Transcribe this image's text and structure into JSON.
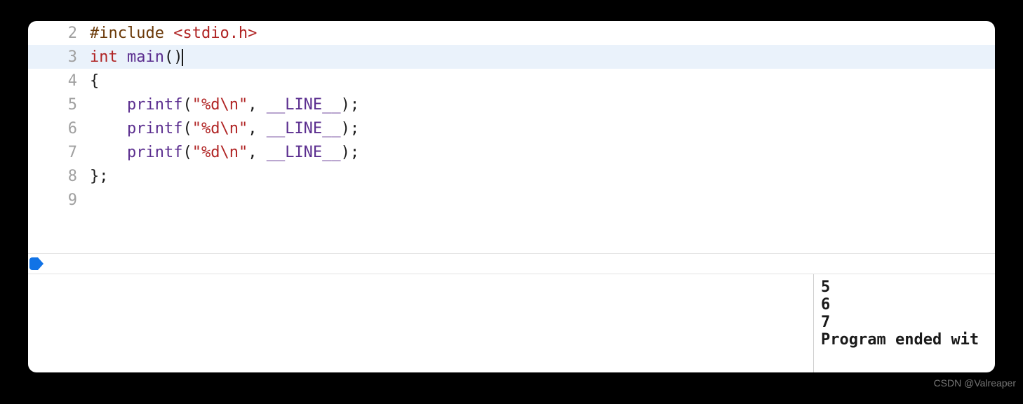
{
  "editor": {
    "lines": [
      {
        "num": "2",
        "highlighted": false,
        "tokens": [
          {
            "cls": "tok-preproc",
            "text": "#include "
          },
          {
            "cls": "tok-include-path",
            "text": "<stdio.h>"
          }
        ]
      },
      {
        "num": "3",
        "highlighted": true,
        "tokens": [
          {
            "cls": "tok-keyword",
            "text": "int "
          },
          {
            "cls": "tok-func",
            "text": "main"
          },
          {
            "cls": "tok-plain",
            "text": "()"
          }
        ],
        "cursor_after": true
      },
      {
        "num": "4",
        "highlighted": false,
        "tokens": [
          {
            "cls": "tok-plain",
            "text": "{"
          }
        ]
      },
      {
        "num": "5",
        "highlighted": false,
        "tokens": [
          {
            "cls": "tok-plain",
            "text": "    "
          },
          {
            "cls": "tok-func",
            "text": "printf"
          },
          {
            "cls": "tok-plain",
            "text": "("
          },
          {
            "cls": "tok-string",
            "text": "\"%d\\n\""
          },
          {
            "cls": "tok-plain",
            "text": ", "
          },
          {
            "cls": "tok-macro",
            "text": "__LINE__"
          },
          {
            "cls": "tok-plain",
            "text": ");"
          }
        ]
      },
      {
        "num": "6",
        "highlighted": false,
        "tokens": [
          {
            "cls": "tok-plain",
            "text": "    "
          },
          {
            "cls": "tok-func",
            "text": "printf"
          },
          {
            "cls": "tok-plain",
            "text": "("
          },
          {
            "cls": "tok-string",
            "text": "\"%d\\n\""
          },
          {
            "cls": "tok-plain",
            "text": ", "
          },
          {
            "cls": "tok-macro",
            "text": "__LINE__"
          },
          {
            "cls": "tok-plain",
            "text": ");"
          }
        ]
      },
      {
        "num": "7",
        "highlighted": false,
        "tokens": [
          {
            "cls": "tok-plain",
            "text": "    "
          },
          {
            "cls": "tok-func",
            "text": "printf"
          },
          {
            "cls": "tok-plain",
            "text": "("
          },
          {
            "cls": "tok-string",
            "text": "\"%d\\n\""
          },
          {
            "cls": "tok-plain",
            "text": ", "
          },
          {
            "cls": "tok-macro",
            "text": "__LINE__"
          },
          {
            "cls": "tok-plain",
            "text": ");"
          }
        ]
      },
      {
        "num": "8",
        "highlighted": false,
        "tokens": [
          {
            "cls": "tok-plain",
            "text": "};"
          }
        ]
      },
      {
        "num": "9",
        "highlighted": false,
        "tokens": []
      }
    ]
  },
  "console": {
    "output": "5\n6\n7\nProgram ended wit"
  },
  "watermark": "CSDN @Valreaper"
}
